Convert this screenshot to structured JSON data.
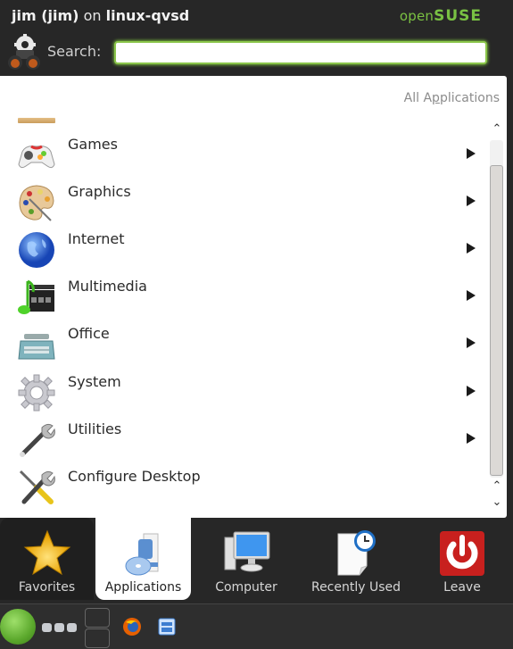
{
  "header": {
    "user": "jim (jim)",
    "on": "on",
    "host": "linux-qvsd",
    "brand_open": "open",
    "brand_suse": "SUSE"
  },
  "search": {
    "label": "Search:",
    "value": "",
    "placeholder": ""
  },
  "panel": {
    "title_prefix": "All A",
    "title_accel": "p",
    "title_suffix": "plications",
    "items": [
      {
        "label": "Games",
        "icon": "gamepad-icon",
        "has_submenu": true
      },
      {
        "label": "Graphics",
        "icon": "palette-icon",
        "has_submenu": true
      },
      {
        "label": "Internet",
        "icon": "globe-icon",
        "has_submenu": true
      },
      {
        "label": "Multimedia",
        "icon": "multimedia-icon",
        "has_submenu": true
      },
      {
        "label": "Office",
        "icon": "typewriter-icon",
        "has_submenu": true
      },
      {
        "label": "System",
        "icon": "gear-icon",
        "has_submenu": true
      },
      {
        "label": "Utilities",
        "icon": "wrench-icon",
        "has_submenu": true
      },
      {
        "label": "Configure Desktop",
        "icon": "configure-tools-icon",
        "has_submenu": false
      }
    ]
  },
  "tabs": [
    {
      "label": "Favorites",
      "icon": "star-icon",
      "active": false
    },
    {
      "label": "Applications",
      "icon": "applications-icon",
      "active": true
    },
    {
      "label": "Computer",
      "icon": "computer-icon",
      "active": false
    },
    {
      "label": "Recently Used",
      "icon": "recent-document-icon",
      "active": false
    },
    {
      "label": "Leave",
      "icon": "power-icon",
      "active": false
    }
  ],
  "taskbar": {
    "launchers": [
      "kickoff-menu",
      "pager",
      "firefox",
      "file-manager"
    ]
  },
  "colors": {
    "accent": "#79c143",
    "header_bg": "#272727",
    "panel_bg": "#ffffff",
    "search_border": "#8ac54a",
    "leave_red": "#c8201e"
  }
}
